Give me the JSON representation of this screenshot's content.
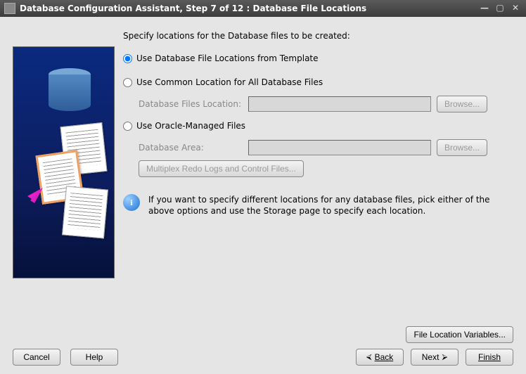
{
  "titlebar": {
    "title": "Database Configuration Assistant, Step 7 of 12 : Database File Locations"
  },
  "prompt": "Specify locations for the Database files to be created:",
  "options": {
    "template": {
      "label": "Use Database File Locations from Template",
      "selected": true
    },
    "common": {
      "label": "Use Common Location for All Database Files",
      "selected": false,
      "fieldLabel": "Database Files Location:",
      "value": "",
      "browse": "Browse..."
    },
    "omf": {
      "label": "Use Oracle-Managed Files",
      "selected": false,
      "fieldLabel": "Database Area:",
      "value": "",
      "browse": "Browse...",
      "multiplex": "Multiplex Redo Logs and Control Files..."
    }
  },
  "info": {
    "text": "If you want to specify different locations for any database files, pick either of the above options and use the Storage page to specify each location."
  },
  "fileVarButton": "File Location Variables...",
  "footer": {
    "cancel": "Cancel",
    "help": "Help",
    "back": "Back",
    "next": "Next",
    "finish": "Finish"
  }
}
